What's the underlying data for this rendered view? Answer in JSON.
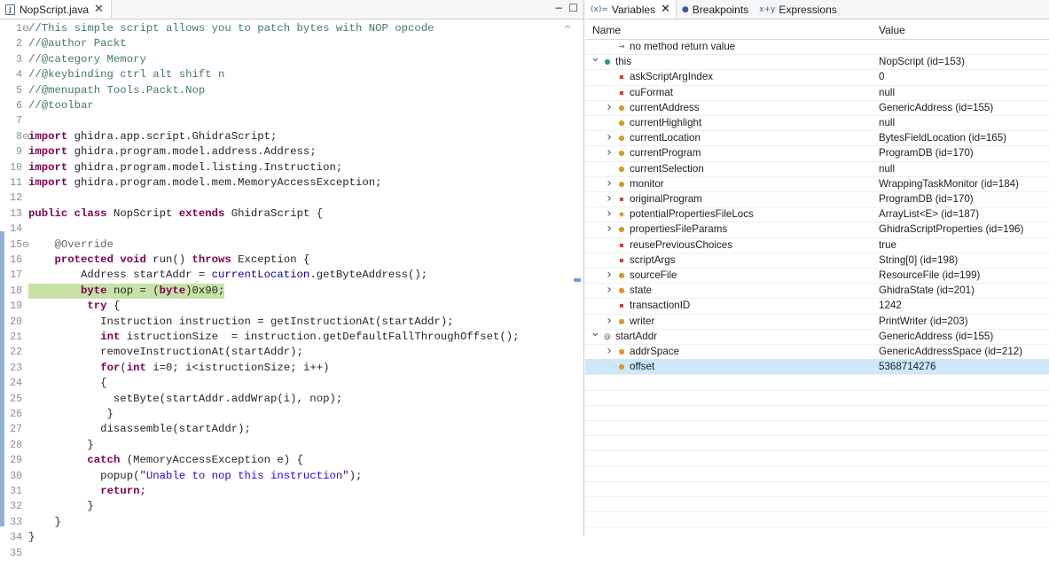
{
  "editor": {
    "tab_label": "NopScript.java",
    "tab_close": "✕",
    "controls": {
      "minimize": "−",
      "maximize": "☐"
    },
    "lines": [
      {
        "n": "1",
        "fold": true,
        "parts": [
          [
            "cmt",
            "//This simple script allows you to patch bytes with NOP opcode"
          ]
        ]
      },
      {
        "n": "2",
        "parts": [
          [
            "cmt",
            "//@author Packt"
          ]
        ]
      },
      {
        "n": "3",
        "parts": [
          [
            "cmt",
            "//@category Memory"
          ]
        ]
      },
      {
        "n": "4",
        "parts": [
          [
            "cmt",
            "//@keybinding ctrl alt shift n"
          ]
        ]
      },
      {
        "n": "5",
        "parts": [
          [
            "cmt",
            "//@menupath Tools.Packt.Nop"
          ]
        ]
      },
      {
        "n": "6",
        "parts": [
          [
            "cmt",
            "//@toolbar"
          ]
        ]
      },
      {
        "n": "7",
        "parts": []
      },
      {
        "n": "8",
        "fold": true,
        "parts": [
          [
            "kw",
            "import"
          ],
          [
            "",
            " ghidra.app.script.GhidraScript;"
          ]
        ]
      },
      {
        "n": "9",
        "parts": [
          [
            "kw",
            "import"
          ],
          [
            "",
            " ghidra.program.model.address.Address;"
          ]
        ]
      },
      {
        "n": "10",
        "parts": [
          [
            "kw",
            "import"
          ],
          [
            "",
            " ghidra.program.model.listing.Instruction;"
          ]
        ]
      },
      {
        "n": "11",
        "parts": [
          [
            "kw",
            "import"
          ],
          [
            "",
            " ghidra.program.model.mem.MemoryAccessException;"
          ]
        ]
      },
      {
        "n": "12",
        "parts": []
      },
      {
        "n": "13",
        "parts": [
          [
            "kw",
            "public class"
          ],
          [
            "",
            " NopScript "
          ],
          [
            "kw",
            "extends"
          ],
          [
            "",
            " GhidraScript {"
          ]
        ]
      },
      {
        "n": "14",
        "parts": []
      },
      {
        "n": "15",
        "fold": true,
        "parts": [
          [
            "ann",
            "    @Override"
          ]
        ]
      },
      {
        "n": "16",
        "parts": [
          [
            "",
            "    "
          ],
          [
            "kw",
            "protected void"
          ],
          [
            "",
            " run() "
          ],
          [
            "kw",
            "throws"
          ],
          [
            "",
            " Exception {"
          ]
        ]
      },
      {
        "n": "17",
        "parts": [
          [
            "",
            "        Address startAddr = "
          ],
          [
            "fld",
            "currentLocation"
          ],
          [
            "",
            ".getByteAddress();"
          ]
        ]
      },
      {
        "n": "18",
        "hl": true,
        "parts": [
          [
            "",
            "        "
          ],
          [
            "kw",
            "byte"
          ],
          [
            "",
            " nop = ("
          ],
          [
            "kw",
            "byte"
          ],
          [
            "",
            ")0x90;"
          ]
        ]
      },
      {
        "n": "19",
        "parts": [
          [
            "",
            "         "
          ],
          [
            "kw",
            "try"
          ],
          [
            "",
            " {"
          ]
        ]
      },
      {
        "n": "20",
        "parts": [
          [
            "",
            "           Instruction instruction = getInstructionAt(startAddr);"
          ]
        ]
      },
      {
        "n": "21",
        "parts": [
          [
            "",
            "           "
          ],
          [
            "kw",
            "int"
          ],
          [
            "",
            " istructionSize  = instruction.getDefaultFallThroughOffset();"
          ]
        ]
      },
      {
        "n": "22",
        "parts": [
          [
            "",
            "           removeInstructionAt(startAddr);"
          ]
        ]
      },
      {
        "n": "23",
        "parts": [
          [
            "",
            "           "
          ],
          [
            "kw",
            "for"
          ],
          [
            "",
            "("
          ],
          [
            "kw",
            "int"
          ],
          [
            "",
            " i=0; i<istructionSize; i++)"
          ]
        ]
      },
      {
        "n": "24",
        "parts": [
          [
            "",
            "           {"
          ]
        ]
      },
      {
        "n": "25",
        "parts": [
          [
            "",
            "             setByte(startAddr.addWrap(i), nop);"
          ]
        ]
      },
      {
        "n": "26",
        "parts": [
          [
            "",
            "            }"
          ]
        ]
      },
      {
        "n": "27",
        "parts": [
          [
            "",
            "           disassemble(startAddr);"
          ]
        ]
      },
      {
        "n": "28",
        "parts": [
          [
            "",
            "         }"
          ]
        ]
      },
      {
        "n": "29",
        "parts": [
          [
            "",
            "         "
          ],
          [
            "kw",
            "catch"
          ],
          [
            "",
            " (MemoryAccessException e) {"
          ]
        ]
      },
      {
        "n": "30",
        "parts": [
          [
            "",
            "           popup("
          ],
          [
            "str",
            "\"Unable to nop this instruction\""
          ],
          [
            "",
            ");"
          ]
        ]
      },
      {
        "n": "31",
        "parts": [
          [
            "",
            "           "
          ],
          [
            "kw",
            "return"
          ],
          [
            "",
            ";"
          ]
        ]
      },
      {
        "n": "32",
        "parts": [
          [
            "",
            "         }"
          ]
        ]
      },
      {
        "n": "33",
        "parts": [
          [
            "",
            "    }"
          ]
        ]
      },
      {
        "n": "34",
        "parts": [
          [
            "",
            "}"
          ]
        ]
      },
      {
        "n": "35",
        "parts": []
      }
    ]
  },
  "variables": {
    "tabs": [
      {
        "label": "Variables",
        "icon": "(x)=",
        "close": "✕",
        "active": true
      },
      {
        "label": "Breakpoints",
        "icon": "●",
        "active": false
      },
      {
        "label": "Expressions",
        "icon": "x+y",
        "active": false
      }
    ],
    "columns": {
      "name": "Name",
      "value": "Value"
    },
    "rows": [
      {
        "indent": 1,
        "expander": "",
        "icon": "return-icon",
        "name": "no method return value",
        "value": ""
      },
      {
        "indent": 0,
        "expander": "v",
        "icon": "green",
        "name": "this",
        "value": "NopScript  (id=153)"
      },
      {
        "indent": 1,
        "expander": "",
        "icon": "red",
        "name": "askScriptArgIndex",
        "value": "0"
      },
      {
        "indent": 1,
        "expander": "",
        "icon": "red",
        "name": "cuFormat",
        "value": "null"
      },
      {
        "indent": 1,
        "expander": ">",
        "icon": "orange",
        "name": "currentAddress",
        "value": "GenericAddress  (id=155)"
      },
      {
        "indent": 1,
        "expander": "",
        "icon": "orange",
        "name": "currentHighlight",
        "value": "null"
      },
      {
        "indent": 1,
        "expander": ">",
        "icon": "orange",
        "name": "currentLocation",
        "value": "BytesFieldLocation  (id=165)"
      },
      {
        "indent": 1,
        "expander": ">",
        "icon": "orange",
        "name": "currentProgram",
        "value": "ProgramDB  (id=170)"
      },
      {
        "indent": 1,
        "expander": "",
        "icon": "orange",
        "name": "currentSelection",
        "value": "null"
      },
      {
        "indent": 1,
        "expander": ">",
        "icon": "orange",
        "name": "monitor",
        "value": "WrappingTaskMonitor  (id=184)"
      },
      {
        "indent": 1,
        "expander": ">",
        "icon": "red",
        "name": "originalProgram",
        "value": "ProgramDB  (id=170)"
      },
      {
        "indent": 1,
        "expander": ">",
        "icon": "static",
        "name": "potentialPropertiesFileLocs",
        "value": "ArrayList<E>  (id=187)"
      },
      {
        "indent": 1,
        "expander": ">",
        "icon": "orange",
        "name": "propertiesFileParams",
        "value": "GhidraScriptProperties  (id=196)"
      },
      {
        "indent": 1,
        "expander": "",
        "icon": "red",
        "name": "reusePreviousChoices",
        "value": "true"
      },
      {
        "indent": 1,
        "expander": "",
        "icon": "red",
        "name": "scriptArgs",
        "value": "String[0]  (id=198)"
      },
      {
        "indent": 1,
        "expander": ">",
        "icon": "orange",
        "name": "sourceFile",
        "value": "ResourceFile  (id=199)"
      },
      {
        "indent": 1,
        "expander": ">",
        "icon": "orange",
        "name": "state",
        "value": "GhidraState  (id=201)"
      },
      {
        "indent": 1,
        "expander": "",
        "icon": "red",
        "name": "transactionID",
        "value": "1242"
      },
      {
        "indent": 1,
        "expander": ">",
        "icon": "orange",
        "name": "writer",
        "value": "PrintWriter  (id=203)"
      },
      {
        "indent": 0,
        "expander": "v",
        "icon": "at",
        "name": "startAddr",
        "value": "GenericAddress  (id=155)"
      },
      {
        "indent": 1,
        "expander": ">",
        "icon": "orange",
        "name": "addrSpace",
        "value": "GenericAddressSpace  (id=212)"
      },
      {
        "indent": 1,
        "expander": "",
        "icon": "orange",
        "name": "offset",
        "value": "5368714276",
        "selected": true
      }
    ]
  }
}
